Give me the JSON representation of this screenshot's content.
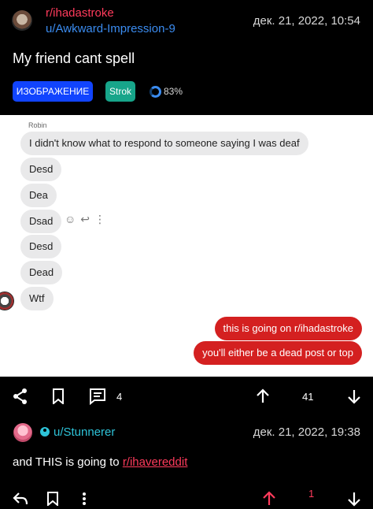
{
  "post": {
    "subreddit": "r/ihadastroke",
    "author": "u/Awkward-Impression-9",
    "date": "дек. 21, 2022, 10:54",
    "title": "My friend cant spell",
    "tags": {
      "type": "ИЗОБРАЖЕНИЕ",
      "flair": "Strok"
    },
    "upvote_ratio": "83%",
    "actions": {
      "comments": "4",
      "score": "41"
    }
  },
  "image": {
    "sender": "Robin",
    "incoming": [
      "I didn't know what to respond to someone saying I was deaf",
      "Desd",
      "Dea",
      "Dsad",
      "Desd",
      "Dead",
      "Wtf"
    ],
    "outgoing": [
      "this is going on r/ihadastroke",
      "you'll either be a dead post or top"
    ]
  },
  "comment": {
    "author": "u/Stunnerer",
    "date": "дек. 21, 2022, 19:38",
    "text": "and THIS is going to ",
    "link": "r/ihavereddit",
    "score": "1"
  },
  "colors": {
    "subreddit": "#ff3b5c",
    "author": "#3b8cf0",
    "tag_image": "#1144ff",
    "tag_flair": "#17a58a",
    "outgoing_bubble": "#d42020",
    "comment_author": "#2ec3d8",
    "upvoted": "#ff3b5c"
  }
}
